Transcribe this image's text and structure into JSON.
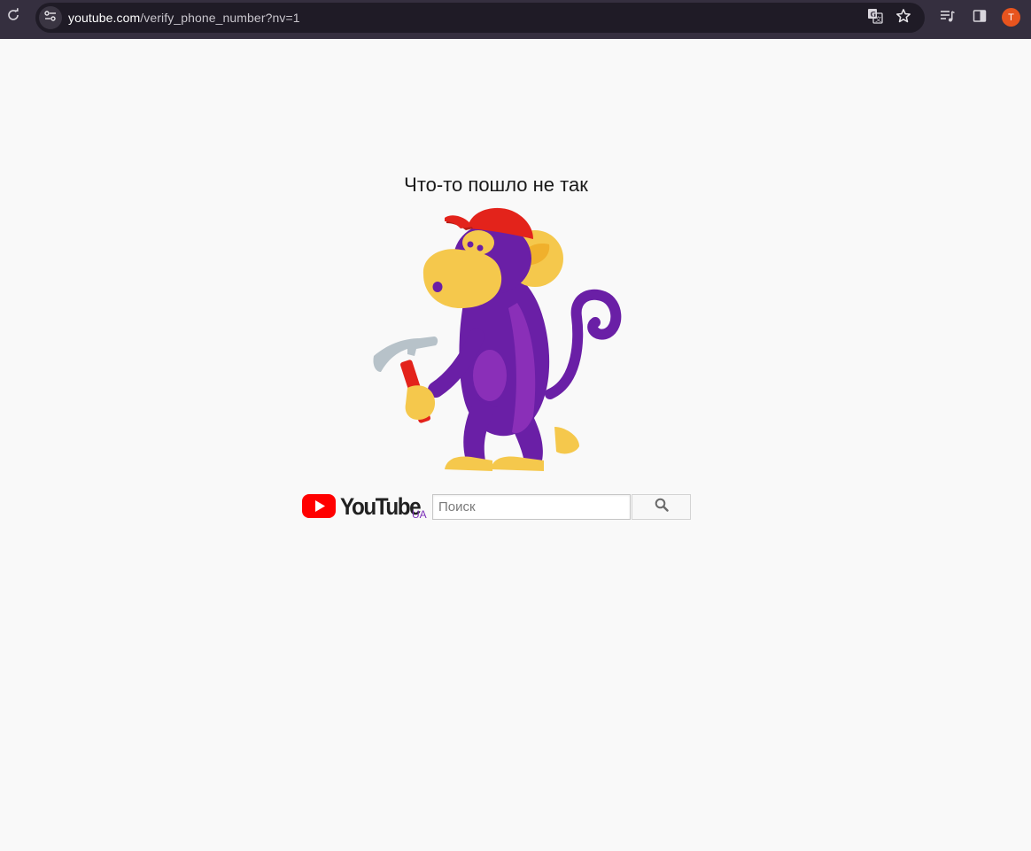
{
  "browser": {
    "url_host": "youtube.com",
    "url_path": "/verify_phone_number?nv=1",
    "profile_initial": "T",
    "icons": [
      "reload-icon",
      "site-info-icon",
      "translate-icon",
      "bookmark-star-icon",
      "media-control-icon",
      "side-panel-icon"
    ]
  },
  "page": {
    "title": "Что-то пошло не так",
    "logo_text": "YouTube",
    "logo_country": "UA",
    "search_placeholder": "Поиск",
    "search_value": ""
  },
  "colors": {
    "toolbar": "#352f3f",
    "omnibox": "#1f1b26",
    "page_background": "#f9f9f9",
    "youtube_red": "#ff0000",
    "country_code": "#7b2fb7",
    "avatar": "#e8541e",
    "monkey_purple": "#6a1fa6",
    "monkey_yellow": "#f5c84c",
    "hat_red": "#e3231b"
  }
}
